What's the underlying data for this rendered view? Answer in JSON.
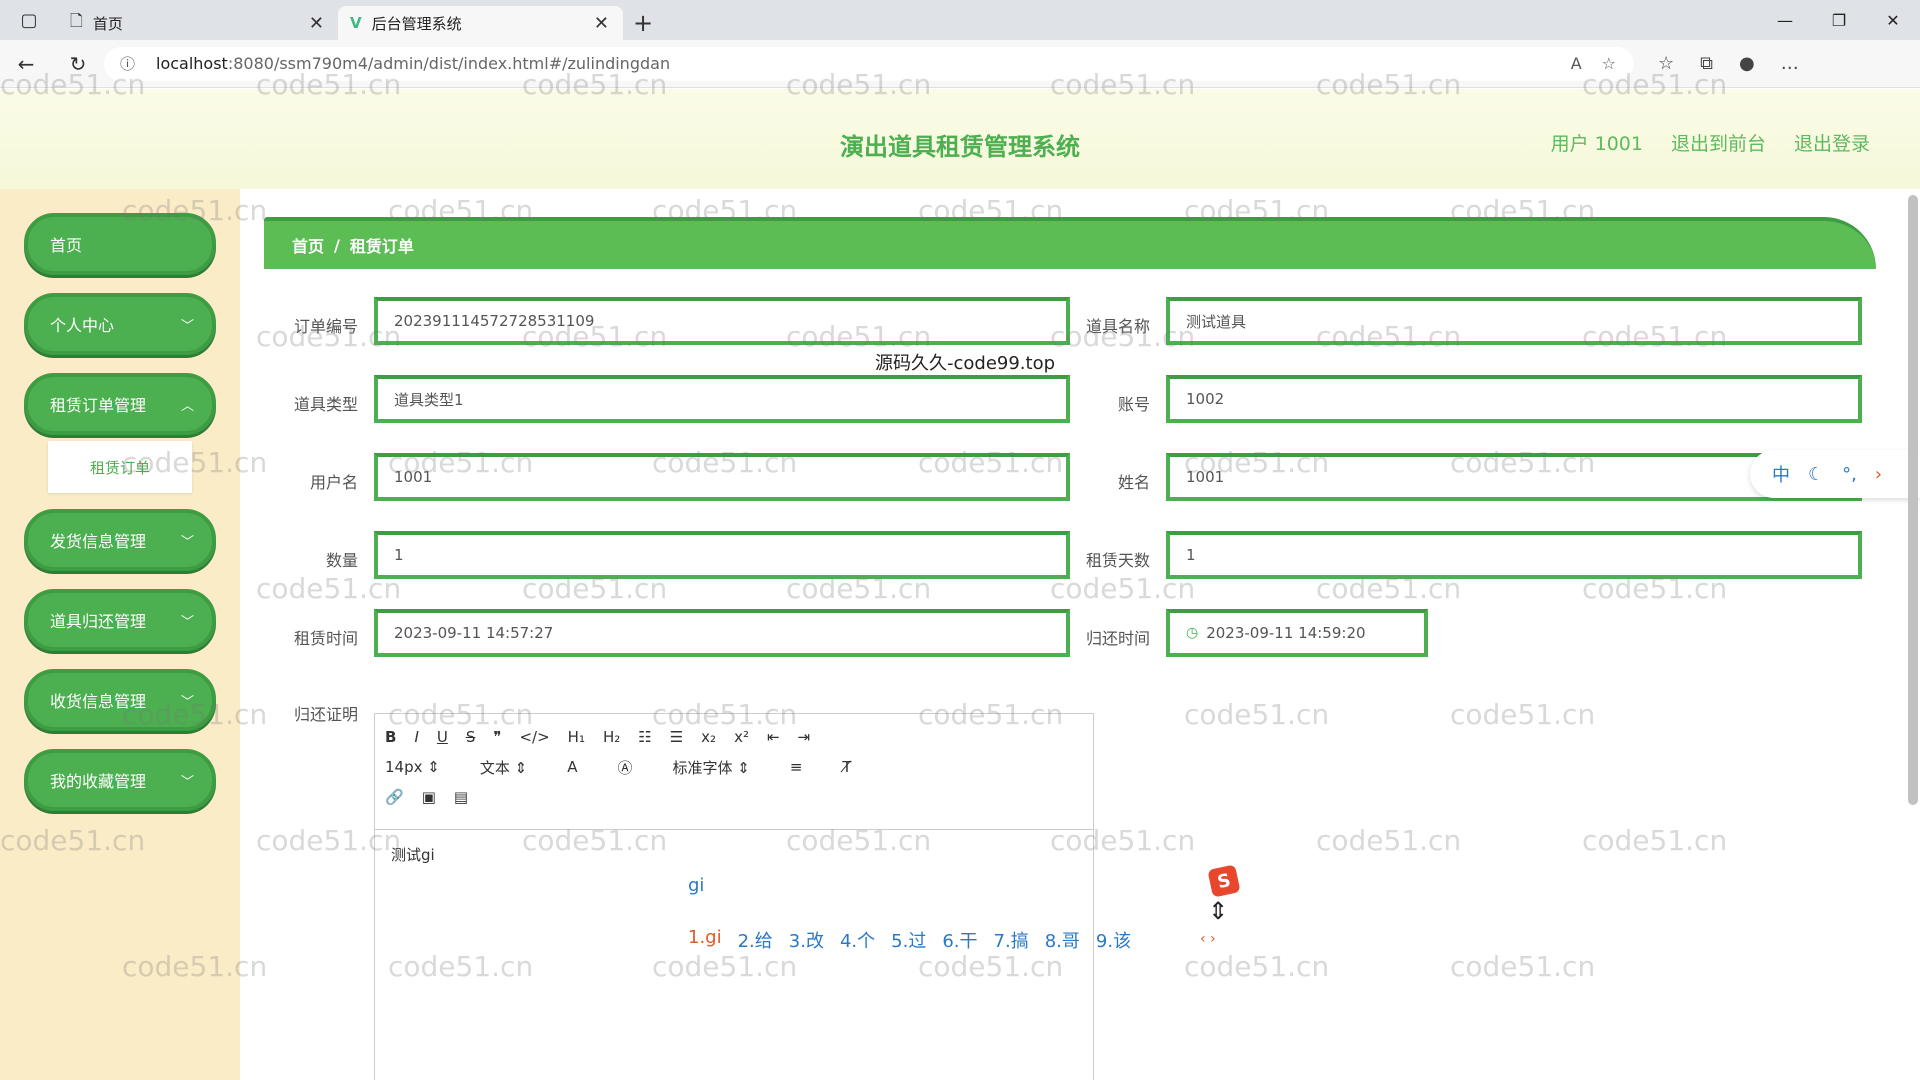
{
  "browser": {
    "tabs": [
      {
        "title": "首页",
        "active": false
      },
      {
        "title": "后台管理系统",
        "active": true
      }
    ],
    "url_host": "localhost",
    "url_path": ":8080/ssm790m4/admin/dist/index.html#/zulindingdan"
  },
  "header": {
    "title": "演出道具租赁管理系统",
    "user": "用户 1001",
    "back_front": "退出到前台",
    "logout": "退出登录"
  },
  "sidebar": {
    "items": [
      {
        "label": "首页",
        "has_children": false
      },
      {
        "label": "个人中心",
        "has_children": true
      },
      {
        "label": "租赁订单管理",
        "has_children": true
      },
      {
        "label": "发货信息管理",
        "has_children": true
      },
      {
        "label": "道具归还管理",
        "has_children": true
      },
      {
        "label": "收货信息管理",
        "has_children": true
      },
      {
        "label": "我的收藏管理",
        "has_children": true
      }
    ],
    "submenu_active": "租赁订单"
  },
  "breadcrumb": {
    "home": "首页",
    "separator": "/",
    "current": "租赁订单"
  },
  "form": {
    "order_no": {
      "label": "订单编号",
      "value": "2023911145727285311​09"
    },
    "prop_name": {
      "label": "道具名称",
      "value": "测试道具"
    },
    "prop_type": {
      "label": "道具类型",
      "value": "道具类型1"
    },
    "account": {
      "label": "账号",
      "value": "1002"
    },
    "username": {
      "label": "用户名",
      "value": "1001"
    },
    "realname": {
      "label": "姓名",
      "value": "1001"
    },
    "quantity": {
      "label": "数量",
      "value": "1"
    },
    "rent_days": {
      "label": "租赁天数",
      "value": "1"
    },
    "rent_time": {
      "label": "租赁时间",
      "value": "2023-09-11 14:57:27"
    },
    "return_time": {
      "label": "归还时间",
      "value": "2023-09-11 14:59:20"
    },
    "return_proof": {
      "label": "归还证明"
    }
  },
  "overlay": "源码久久-code99.top",
  "editor": {
    "font_size": "14px",
    "paragraph": "文本",
    "font_family": "标准字体",
    "content": "测试gi"
  },
  "ime": {
    "input": "gi",
    "candidates": [
      "1.gi",
      "2.给",
      "3.改",
      "4.个",
      "5.过",
      "6.干",
      "7.搞",
      "8.哥",
      "9.该"
    ],
    "logo": "S",
    "bar_lang": "中"
  },
  "watermark": "code51.cn",
  "colors": {
    "accent": "#4caf50",
    "sidebar_bg": "#fbecc8",
    "header_bg": "#f5f8d8"
  }
}
